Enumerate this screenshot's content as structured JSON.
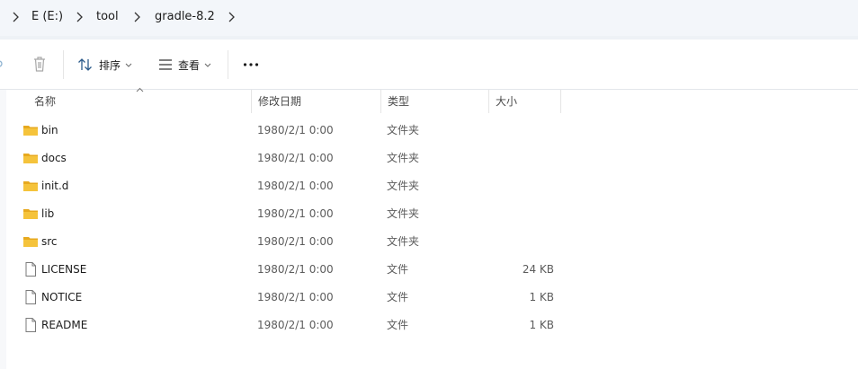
{
  "breadcrumb": [
    {
      "label": "E (E:)"
    },
    {
      "label": "tool"
    },
    {
      "label": "gradle-8.2"
    }
  ],
  "toolbar": {
    "sort_label": "排序",
    "view_label": "查看",
    "more_label": "···"
  },
  "columns": {
    "name": "名称",
    "date": "修改日期",
    "type": "类型",
    "size": "大小"
  },
  "files": [
    {
      "name": "bin",
      "date": "1980/2/1 0:00",
      "type": "文件夹",
      "size": "",
      "icon": "folder-icon"
    },
    {
      "name": "docs",
      "date": "1980/2/1 0:00",
      "type": "文件夹",
      "size": "",
      "icon": "folder-icon"
    },
    {
      "name": "init.d",
      "date": "1980/2/1 0:00",
      "type": "文件夹",
      "size": "",
      "icon": "folder-icon"
    },
    {
      "name": "lib",
      "date": "1980/2/1 0:00",
      "type": "文件夹",
      "size": "",
      "icon": "folder-icon"
    },
    {
      "name": "src",
      "date": "1980/2/1 0:00",
      "type": "文件夹",
      "size": "",
      "icon": "folder-icon"
    },
    {
      "name": "LICENSE",
      "date": "1980/2/1 0:00",
      "type": "文件",
      "size": "24 KB",
      "icon": "file-icon"
    },
    {
      "name": "NOTICE",
      "date": "1980/2/1 0:00",
      "type": "文件",
      "size": "1 KB",
      "icon": "file-icon"
    },
    {
      "name": "README",
      "date": "1980/2/1 0:00",
      "type": "文件",
      "size": "1 KB",
      "icon": "file-icon"
    }
  ],
  "colors": {
    "folder": "#f5c33b",
    "folder_dark": "#e7a91f",
    "address_bg": "#f3f6fa"
  }
}
